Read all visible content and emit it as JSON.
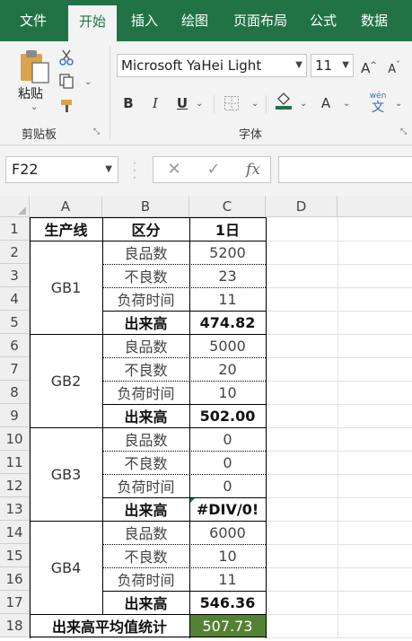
{
  "ribbon": {
    "tabs": [
      "文件",
      "开始",
      "插入",
      "绘图",
      "页面布局",
      "公式",
      "数据"
    ],
    "active_tab": "开始",
    "clipboard": {
      "paste_label": "粘贴",
      "group_label": "剪贴板"
    },
    "font": {
      "font_name": "Microsoft YaHei Light",
      "font_size": "11",
      "group_label": "字体",
      "bold_label": "B",
      "italic_label": "I",
      "underline_label": "U",
      "grow_label": "A",
      "shrink_label": "A",
      "font_color_label": "A",
      "phonetic_top": "wén",
      "phonetic_bottom": "文"
    }
  },
  "formula_bar": {
    "name_box": "F22",
    "fx_label": "fx",
    "formula": ""
  },
  "columns": [
    "A",
    "B",
    "C",
    "D"
  ],
  "rows": [
    "1",
    "2",
    "3",
    "4",
    "5",
    "6",
    "7",
    "8",
    "9",
    "10",
    "11",
    "12",
    "13",
    "14",
    "15",
    "16",
    "17",
    "18"
  ],
  "table": {
    "header": {
      "line": "生产线",
      "category": "区分",
      "day": "1日"
    },
    "groups": [
      {
        "name": "GB1",
        "items": [
          {
            "label": "良品数",
            "value": "5200"
          },
          {
            "label": "不良数",
            "value": "23"
          },
          {
            "label": "负荷时间",
            "value": "11"
          },
          {
            "label": "出来高",
            "value": "474.82"
          }
        ]
      },
      {
        "name": "GB2",
        "items": [
          {
            "label": "良品数",
            "value": "5000"
          },
          {
            "label": "不良数",
            "value": "20"
          },
          {
            "label": "负荷时间",
            "value": "10"
          },
          {
            "label": "出来高",
            "value": "502.00"
          }
        ]
      },
      {
        "name": "GB3",
        "items": [
          {
            "label": "良品数",
            "value": "0"
          },
          {
            "label": "不良数",
            "value": "0"
          },
          {
            "label": "负荷时间",
            "value": "0"
          },
          {
            "label": "出来高",
            "value": "#DIV/0!"
          }
        ]
      },
      {
        "name": "GB4",
        "items": [
          {
            "label": "良品数",
            "value": "6000"
          },
          {
            "label": "不良数",
            "value": "10"
          },
          {
            "label": "负荷时间",
            "value": "11"
          },
          {
            "label": "出来高",
            "value": "546.36"
          }
        ]
      }
    ],
    "summary": {
      "label": "出来高平均值统计",
      "value": "507.73"
    }
  },
  "colors": {
    "excel_green": "#217346",
    "highlight_fill": "#548235",
    "error_indicator": "#1f7a3c"
  }
}
